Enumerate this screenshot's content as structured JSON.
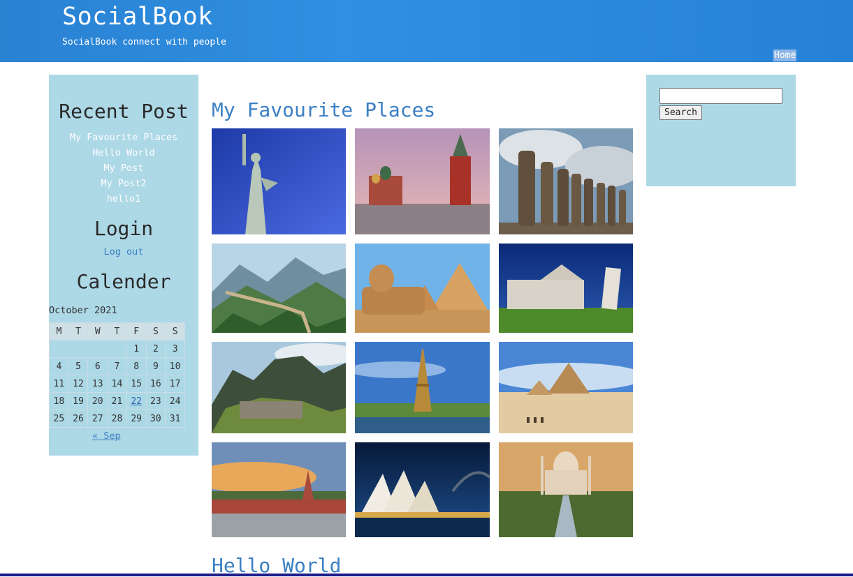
{
  "header": {
    "site_title": "SocialBook",
    "tagline": "SocialBook connect with people",
    "nav_home": "Home"
  },
  "sidebar": {
    "recent_heading": "Recent Post",
    "recent_posts": [
      "My Favourite Places",
      "Hello World",
      "My Post",
      "My Post2",
      "hello1"
    ],
    "login_heading": "Login",
    "logout_label": "Log out",
    "calendar_heading": "Calender",
    "calendar": {
      "caption": "October 2021",
      "weekdays": [
        "M",
        "T",
        "W",
        "T",
        "F",
        "S",
        "S"
      ],
      "weeks": [
        [
          "",
          "",
          "",
          "",
          "1",
          "2",
          "3"
        ],
        [
          "4",
          "5",
          "6",
          "7",
          "8",
          "9",
          "10"
        ],
        [
          "11",
          "12",
          "13",
          "14",
          "15",
          "16",
          "17"
        ],
        [
          "18",
          "19",
          "20",
          "21",
          "22",
          "23",
          "24"
        ],
        [
          "25",
          "26",
          "27",
          "28",
          "29",
          "30",
          "31"
        ]
      ],
      "linked_day": "22",
      "prev_link": "« Sep"
    }
  },
  "main": {
    "post_title": "My Favourite Places",
    "next_post_title": "Hello World",
    "photos": [
      "statue-of-liberty",
      "red-square-moscow",
      "easter-island-moai",
      "great-wall-china",
      "great-sphinx-giza",
      "leaning-tower-pisa",
      "machu-picchu",
      "eiffel-tower",
      "pyramids-desert",
      "kremlin-riverside",
      "sydney-opera-house",
      "taj-mahal"
    ]
  },
  "search": {
    "input_value": "",
    "button_label": "Search"
  },
  "colors": {
    "header": "#2a82d3",
    "sidebar": "#add8e6",
    "link": "#3b7fc4",
    "bottom_bar": "#1e1e8c"
  }
}
